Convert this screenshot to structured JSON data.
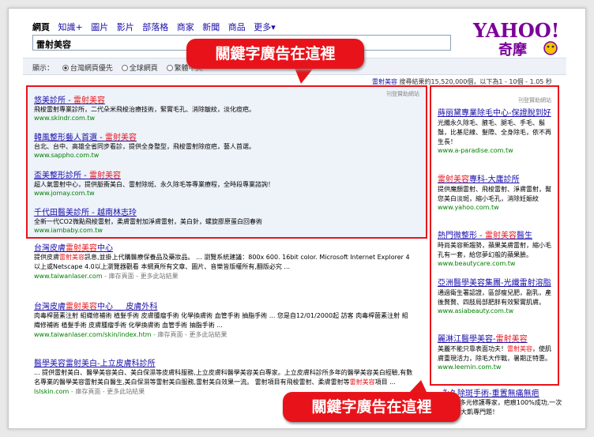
{
  "tabs": [
    "網頁",
    "知識+",
    "圖片",
    "影片",
    "部落格",
    "商家",
    "新聞",
    "商品",
    "更多▾"
  ],
  "search": {
    "query": "雷射美容"
  },
  "logo": {
    "text": "YAHOO!",
    "subtext": "奇摩"
  },
  "filter": {
    "label": "顯示：",
    "options": [
      "台灣網頁優先",
      "全球網頁",
      "繁體中文"
    ]
  },
  "result_count": {
    "query": "雷射美容",
    "text": "搜尋結果約15,520,000個，以下為1 - 10個 - 1.05 秒"
  },
  "sponsor_label": "刊登贊助網站",
  "left_ads": [
    {
      "title": "悠美診所 - 雷射美容",
      "desc": "飛梭雷射專業診所，二代朵米飛梭治療技術，緊實毛孔、消除皺紋，淡化痘疤。",
      "url": "www.skindr.com.tw"
    },
    {
      "title": "韓風整形藝人首選 - 雷射美容",
      "desc": "台北、台中、高雄全省同步看診，提供全身整型，飛梭雷射除痘疤，藝人首選。",
      "url": "www.sappho.com.tw"
    },
    {
      "title": "盃美整形診所 - 雷射美容",
      "desc": "超人氣雷射中心，提供脈衝美白、雷射除斑、永久除毛等專業療程，全時段專業諮詢！",
      "url": "www.jomay.com.tw"
    },
    {
      "title": "千代田醫美診所 - 越南林志玲",
      "desc": "全新一代CO2微點飛梭雷射，柔膚雷射加淨膚雷射，美白針，螺旋膠原蛋白回春術",
      "url": "www.iambaby.com.tw"
    }
  ],
  "results": [
    {
      "title": "台灣皮膚雷射美容中心",
      "desc": "提供皮膚雷射美容訊息,並掛上代購醫療保養品及藥妝品。 ... 瀏覽系統建議：800x 600. 16bit color. Microsoft Internet Explorer 4以上或Netscape 4.0以上瀏覽器觀看 本網頁所有文章、圖片、音樂皆版權所有,翻版必究 ...",
      "url": "www.taiwanlaser.com",
      "links": "- 庫存頁面 - 更多此站結果"
    },
    {
      "title": "台灣皮膚雷射美容中心 __ 皮膚外科",
      "desc": "肉毒桿菌素注射 組織修補術 植髮手術 皮膚腫瘤手術 化學換膚術 血管手術 抽脂手術 ... 您是自12/01/2000起 訪客 肉毒桿菌素注射 組織修補術 植髮手術 皮膚腫瘤手術 化學換膚術 血管手術 抽脂手術 ...",
      "url": "www.taiwanlaser.com/skin/index.htm",
      "links": "- 庫存頁面 - 更多此站結果"
    },
    {
      "title": "醫學美容雷射美白-上立皮膚科診所",
      "desc": "... 提供雷射美白、醫學美容美白、美白保濕等皮膚科服務,上立皮膚科醫學美容美白專家。上立皮膚科診所多年的醫學美容美白經驗,有數名專業的醫學美容雷射美白醫生,美白保濕等雷射美白服務,雷射美白效果一流。 雷射項目有飛梭雷射、柔膚雷射等雷射美容項目 ...",
      "url": "lslskin.com",
      "links": "- 庫存頁面 - 更多此站結果"
    }
  ],
  "right_ads": [
    {
      "title": "蒔丽黛專業除毛中心-保證脫到好",
      "desc": "光纖永久除毛、腋毛、腿毛、手毛、鬍鬚，比基尼線、髮際、全身除毛，依不再生長！",
      "url": "www.a-paradise.com.tw"
    },
    {
      "title": "雷射美容專科-大庸診所",
      "desc": "提供魔顏雷射、飛梭雷射、淨膚雷射，幫您美白淡斑，縮小毛孔，消除妊娠紋",
      "url": "www.yahoo.com.tw"
    },
    {
      "title": "熱門微整形 - 雷射美容醫生",
      "desc": "時尚美容新趨勢，蘋果美膚雷射，縮小毛孔有一套，給您夢幻般的蘋果臉。",
      "url": "www.beautycare.com.tw"
    },
    {
      "title": "亞洲醫學美容集團-光纖雷射溶脂",
      "desc": "通過衛生署認證，區部瘦兒肥，副乳，產後贅贅、四肢局部肥胖有效緊實肌膚。",
      "url": "www.asiabeauty.com.tw"
    },
    {
      "title": "麗淋江醫學美容-雷射美容",
      "desc": "美麗不能只靠表面功夫！雷射美容，使肌膚重現活力，除毛大作戰，暑期正特惠。",
      "url": "www.leemin.com.tw"
    }
  ],
  "right_bottom": {
    "title": "永久除斑手術-重置無痛無疤",
    "desc": "100%多元修護專家，疤痕100%成功,一次針對打大凱專門題！"
  },
  "banners": {
    "top": "關鍵字廣告在這裡",
    "bottom": "關鍵字廣告在這裡"
  },
  "colors": {
    "accent": "#e8131a",
    "link": "#1a0dab",
    "url": "#008000",
    "yahoo": "#7b0099"
  }
}
